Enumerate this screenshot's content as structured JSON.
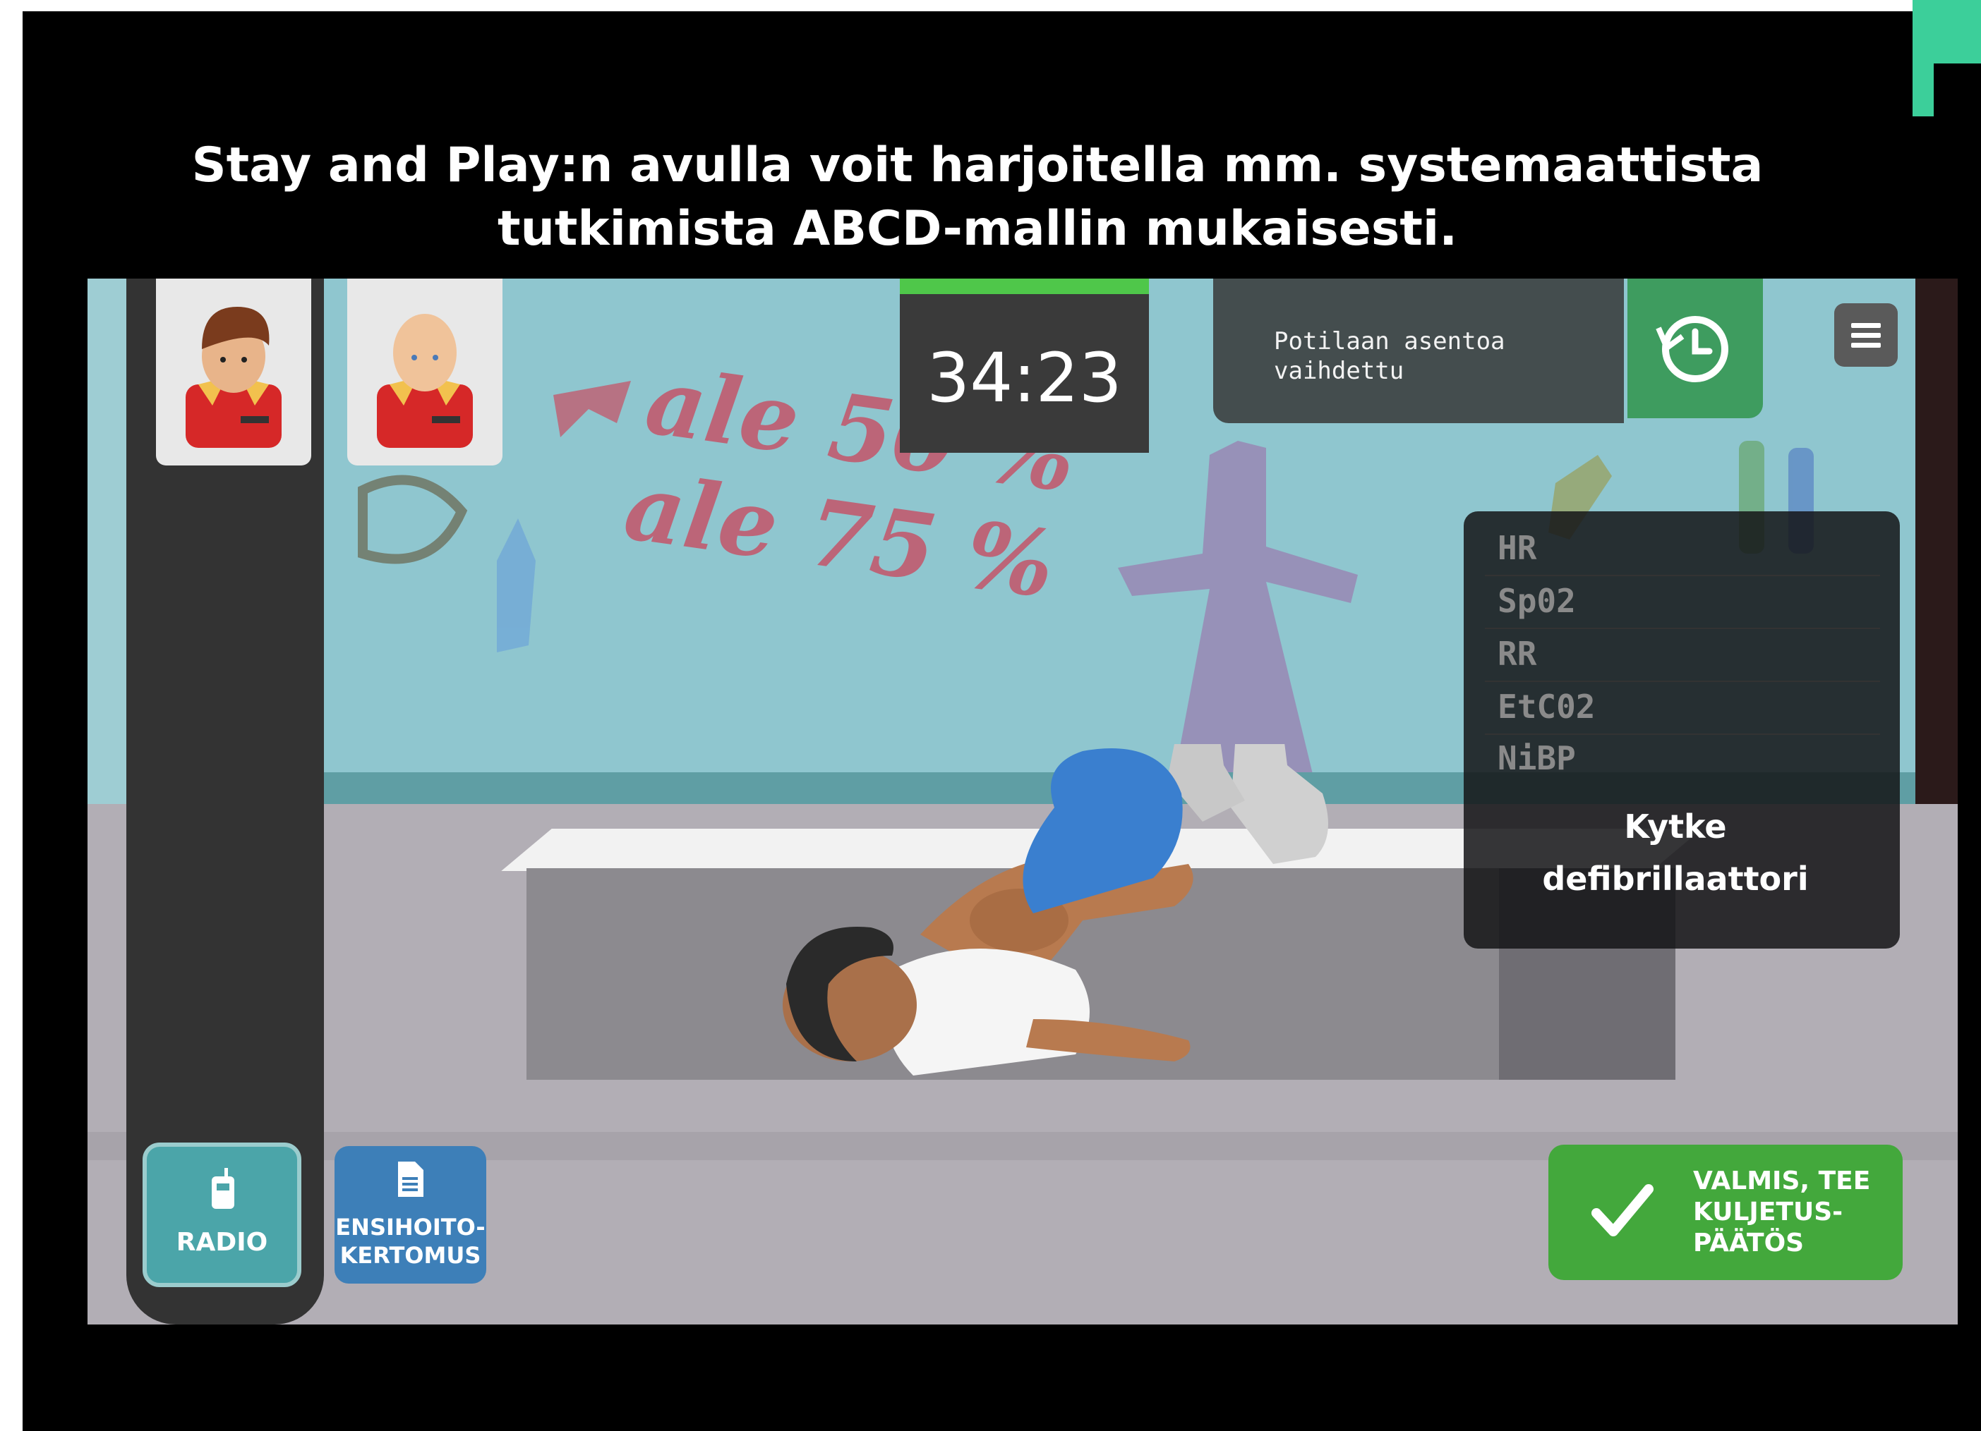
{
  "headline": {
    "line1": "Stay and Play:n avulla voit harjoitella mm. systemaattista",
    "line2": "tutkimista ABCD-mallin mukaisesti."
  },
  "scene": {
    "sale_text_1": "ale 50 %",
    "sale_text_2": "ale 75 %"
  },
  "timer": {
    "value": "34:23"
  },
  "notice": {
    "text": "Potilaan asentoa vaihdettu"
  },
  "history_button": {
    "icon": "history-icon"
  },
  "menu_button": {
    "icon": "hamburger-menu-icon"
  },
  "monitor": {
    "vitals": [
      "HR",
      "Sp02",
      "RR",
      "EtC02",
      "NiBP"
    ],
    "defib_line1": "Kytke",
    "defib_line2": "defibrillaattori"
  },
  "buttons": {
    "radio": "RADIO",
    "report_line1": "ENSIHOITO-",
    "report_line2": "KERTOMUS",
    "done_line1": "VALMIS, TEE",
    "done_line2": "KULJETUS-",
    "done_line3": "PÄÄTÖS"
  },
  "colors": {
    "accent_green": "#43a83c",
    "timer_bar": "#4fc74a",
    "radio_teal": "#4ba5a9",
    "report_blue": "#3d7fb8",
    "corner_mint": "#3ccf9a"
  }
}
